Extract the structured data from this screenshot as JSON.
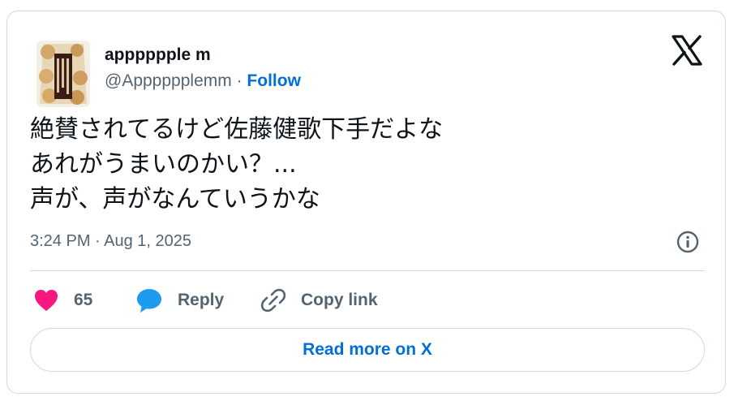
{
  "author": {
    "display_name": "apppppple m",
    "handle": "@Apppppplemm",
    "separator": "·",
    "follow_label": "Follow"
  },
  "tweet": {
    "lines": [
      "絶賛されてるけど佐藤健歌下手だよな",
      "あれがうまいのかい？...",
      "声が、声がなんていうかな"
    ],
    "timestamp": "3:24 PM · Aug 1, 2025"
  },
  "actions": {
    "like_count": "65",
    "reply_label": "Reply",
    "copy_link_label": "Copy link"
  },
  "read_more_label": "Read more on X",
  "colors": {
    "like": "#f91880",
    "reply": "#1d9bf0",
    "link": "#006fd6",
    "muted": "#536471",
    "text": "#0f1419",
    "border": "#cfd9de"
  },
  "icons": {
    "brand": "x-logo-icon",
    "info": "info-icon",
    "like": "heart-icon",
    "reply": "speech-bubble-icon",
    "copy": "link-icon"
  }
}
